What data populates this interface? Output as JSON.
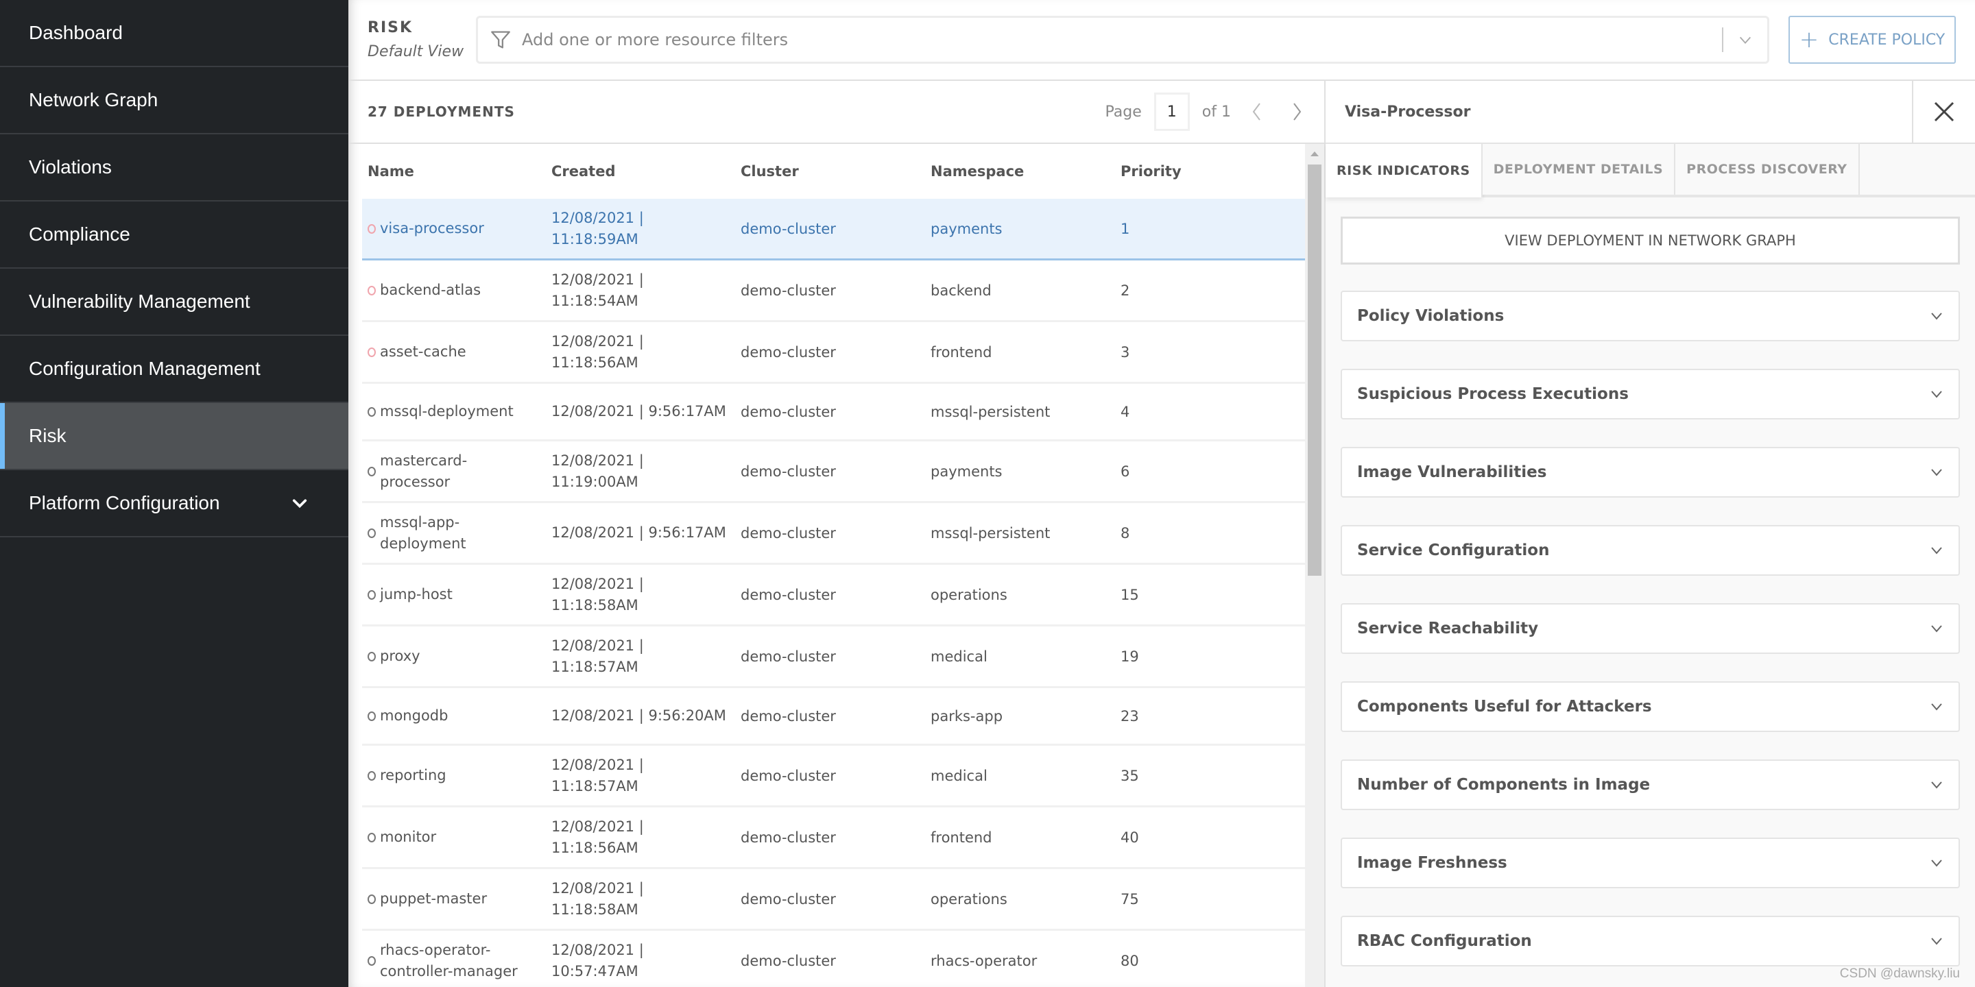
{
  "sidebar": {
    "items": [
      {
        "label": "Dashboard",
        "active": false
      },
      {
        "label": "Network Graph",
        "active": false
      },
      {
        "label": "Violations",
        "active": false
      },
      {
        "label": "Compliance",
        "active": false
      },
      {
        "label": "Vulnerability Management",
        "active": false
      },
      {
        "label": "Configuration Management",
        "active": false
      },
      {
        "label": "Risk",
        "active": true
      },
      {
        "label": "Platform Configuration",
        "active": false,
        "expandable": true
      }
    ]
  },
  "header": {
    "title": "RISK",
    "subtitle": "Default View",
    "filter_placeholder": "Add one or more resource filters",
    "create_policy_label": "CREATE POLICY"
  },
  "list": {
    "count_label": "27 DEPLOYMENTS",
    "pager": {
      "page_label": "Page",
      "current_page": "1",
      "of_label": "of 1"
    },
    "columns": [
      "Name",
      "Created",
      "Cluster",
      "Namespace",
      "Priority"
    ],
    "rows": [
      {
        "name": "visa-processor",
        "created": "12/08/2021 | 11:18:59AM",
        "cluster": "demo-cluster",
        "namespace": "payments",
        "priority": "1",
        "status": "red",
        "selected": true
      },
      {
        "name": "backend-atlas",
        "created": "12/08/2021 | 11:18:54AM",
        "cluster": "demo-cluster",
        "namespace": "backend",
        "priority": "2",
        "status": "red"
      },
      {
        "name": "asset-cache",
        "created": "12/08/2021 | 11:18:56AM",
        "cluster": "demo-cluster",
        "namespace": "frontend",
        "priority": "3",
        "status": "red"
      },
      {
        "name": "mssql-deployment",
        "created": "12/08/2021 | 9:56:17AM",
        "cluster": "demo-cluster",
        "namespace": "mssql-persistent",
        "priority": "4",
        "status": "gray"
      },
      {
        "name": "mastercard-processor",
        "created": "12/08/2021 | 11:19:00AM",
        "cluster": "demo-cluster",
        "namespace": "payments",
        "priority": "6",
        "status": "gray"
      },
      {
        "name": "mssql-app-deployment",
        "created": "12/08/2021 | 9:56:17AM",
        "cluster": "demo-cluster",
        "namespace": "mssql-persistent",
        "priority": "8",
        "status": "gray"
      },
      {
        "name": "jump-host",
        "created": "12/08/2021 | 11:18:58AM",
        "cluster": "demo-cluster",
        "namespace": "operations",
        "priority": "15",
        "status": "gray"
      },
      {
        "name": "proxy",
        "created": "12/08/2021 | 11:18:57AM",
        "cluster": "demo-cluster",
        "namespace": "medical",
        "priority": "19",
        "status": "gray"
      },
      {
        "name": "mongodb",
        "created": "12/08/2021 | 9:56:20AM",
        "cluster": "demo-cluster",
        "namespace": "parks-app",
        "priority": "23",
        "status": "gray"
      },
      {
        "name": "reporting",
        "created": "12/08/2021 | 11:18:57AM",
        "cluster": "demo-cluster",
        "namespace": "medical",
        "priority": "35",
        "status": "gray"
      },
      {
        "name": "monitor",
        "created": "12/08/2021 | 11:18:56AM",
        "cluster": "demo-cluster",
        "namespace": "frontend",
        "priority": "40",
        "status": "gray"
      },
      {
        "name": "puppet-master",
        "created": "12/08/2021 | 11:18:58AM",
        "cluster": "demo-cluster",
        "namespace": "operations",
        "priority": "75",
        "status": "gray"
      },
      {
        "name": "rhacs-operator-controller-manager",
        "created": "12/08/2021 | 10:57:47AM",
        "cluster": "demo-cluster",
        "namespace": "rhacs-operator",
        "priority": "80",
        "status": "gray"
      }
    ]
  },
  "detail": {
    "title": "Visa-Processor",
    "tabs": [
      "RISK INDICATORS",
      "DEPLOYMENT DETAILS",
      "PROCESS DISCOVERY"
    ],
    "active_tab": "RISK INDICATORS",
    "view_graph_label": "VIEW DEPLOYMENT IN NETWORK GRAPH",
    "accordions": [
      "Policy Violations",
      "Suspicious Process Executions",
      "Image Vulnerabilities",
      "Service Configuration",
      "Service Reachability",
      "Components Useful for Attackers",
      "Number of Components in Image",
      "Image Freshness",
      "RBAC Configuration"
    ]
  },
  "colors": {
    "sidebar_bg": "#212427",
    "sidebar_active_bg": "#4f5255",
    "accent": "#73bcf7",
    "selected_row_bg": "#e8f2fc",
    "selected_row_text": "#3c74ad",
    "risk_dot_red": "#f0a5ad"
  },
  "watermark": "CSDN @dawnsky.liu"
}
